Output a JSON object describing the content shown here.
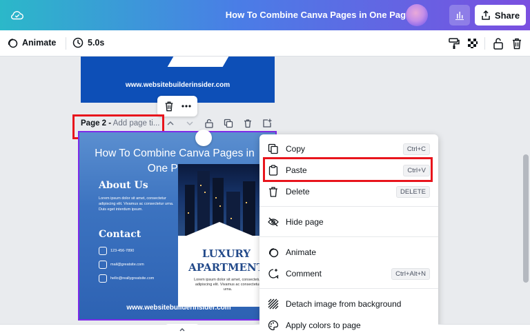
{
  "header": {
    "doc_title": "How To Combine Canva Pages in One Page?",
    "share_label": "Share"
  },
  "toolbar": {
    "animate_label": "Animate",
    "duration_label": "5.0s"
  },
  "page1": {
    "url": "www.websitebuilderinsider.com"
  },
  "page2": {
    "label_prefix": "Page 2 -",
    "label_placeholder": "Add page ti...",
    "title": "How To Combine Canva Pages in One Page?",
    "about_heading": "About Us",
    "about_text": "Lorem ipsum dolor sit amet, consectetur adipiscing elit. Vivamus ac consectetur urna. Duis eget interdum ipsum.",
    "contact_heading": "Contact",
    "phone": "123-456-7890",
    "email": "mail@greatsite.com",
    "email2": "hello@reallygreatsite.com",
    "card_title": "LUXURY APARTMENT",
    "card_text": "Lorem ipsum dolor sit amet, consectetur adipiscing elit. Vivamus ac consectetur urna.",
    "url": "www.websitebuilderinsider.com"
  },
  "context_menu": {
    "items": [
      {
        "label": "Copy",
        "shortcut": "Ctrl+C",
        "icon": "copy-icon"
      },
      {
        "label": "Paste",
        "shortcut": "Ctrl+V",
        "icon": "clipboard-icon"
      },
      {
        "label": "Delete",
        "shortcut": "DELETE",
        "icon": "trash-icon"
      },
      {
        "label": "Hide page",
        "shortcut": "",
        "icon": "eye-off-icon"
      },
      {
        "label": "Animate",
        "shortcut": "",
        "icon": "animate-icon"
      },
      {
        "label": "Comment",
        "shortcut": "Ctrl+Alt+N",
        "icon": "comment-plus-icon"
      },
      {
        "label": "Detach image from background",
        "shortcut": "",
        "icon": "hatch-icon"
      },
      {
        "label": "Apply colors to page",
        "shortcut": "",
        "icon": "palette-icon"
      }
    ]
  },
  "colors": {
    "accent_purple": "#7d2ae8",
    "highlight_red": "#e8141c",
    "page_blue": "#0d4fb7"
  }
}
